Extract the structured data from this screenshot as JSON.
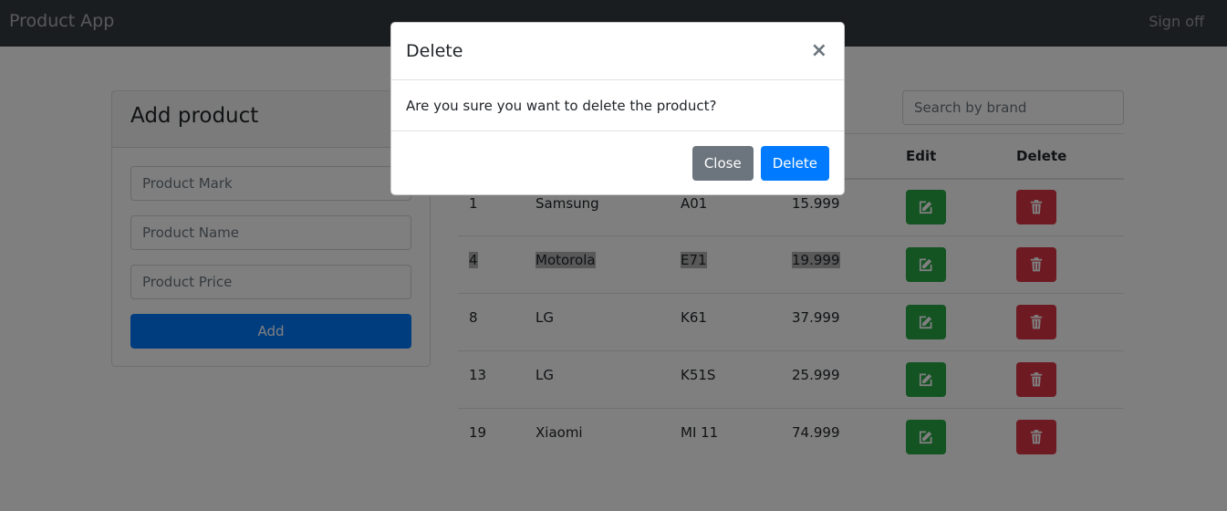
{
  "navbar": {
    "brand": "Product App",
    "signoff": "Sign off"
  },
  "add_card": {
    "title": "Add product",
    "mark_placeholder": "Product Mark",
    "name_placeholder": "Product Name",
    "price_placeholder": "Product Price",
    "add_label": "Add"
  },
  "search": {
    "placeholder": "Search by brand"
  },
  "table": {
    "headers": {
      "edit": "Edit",
      "delete": "Delete"
    },
    "rows": [
      {
        "id": "1",
        "brand": "Samsung",
        "name": "A01",
        "price": "15.999"
      },
      {
        "id": "4",
        "brand": "Motorola",
        "name": "E71",
        "price": "19.999"
      },
      {
        "id": "8",
        "brand": "LG",
        "name": "K61",
        "price": "37.999"
      },
      {
        "id": "13",
        "brand": "LG",
        "name": "K51S",
        "price": "25.999"
      },
      {
        "id": "19",
        "brand": "Xiaomi",
        "name": "MI 11",
        "price": "74.999"
      }
    ]
  },
  "modal": {
    "title": "Delete",
    "close_glyph": "×",
    "message": "Are you sure you want to delete the product?",
    "close_label": "Close",
    "delete_label": "Delete"
  },
  "colors": {
    "navbar": "#343a40",
    "primary": "#007bff",
    "success": "#28a745",
    "danger": "#dc3545",
    "secondary": "#6c757d"
  },
  "icons": {
    "edit": "edit-icon",
    "delete": "trash-icon"
  }
}
